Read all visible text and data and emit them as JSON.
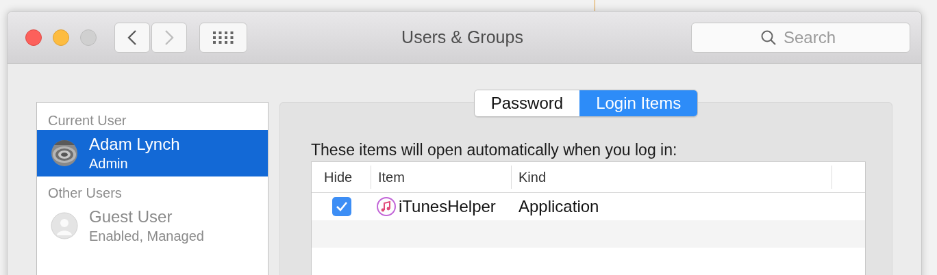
{
  "window": {
    "title": "Users & Groups",
    "nav": [
      {
        "kind": "back",
        "disabled": false
      },
      {
        "kind": "forward",
        "disabled": true
      }
    ],
    "search": {
      "placeholder": "Search"
    }
  },
  "sidebar": {
    "sections": [
      {
        "heading": "Current User",
        "users": [
          {
            "name": "Adam Lynch",
            "role": "Admin",
            "selected": true,
            "kind": "picture"
          }
        ]
      },
      {
        "heading": "Other Users",
        "users": [
          {
            "name": "Guest User",
            "role": "Enabled, Managed",
            "selected": false,
            "kind": "silhouette"
          }
        ]
      }
    ]
  },
  "tabs": [
    {
      "label": "Password",
      "selected": false
    },
    {
      "label": "Login Items",
      "selected": true
    }
  ],
  "intro": "These items will open automatically when you log in:",
  "table": {
    "columns": [
      "Hide",
      "Item",
      "Kind"
    ],
    "rows": [
      {
        "hidden": true,
        "item": "iTunesHelper",
        "item_kind": "Application"
      }
    ]
  }
}
